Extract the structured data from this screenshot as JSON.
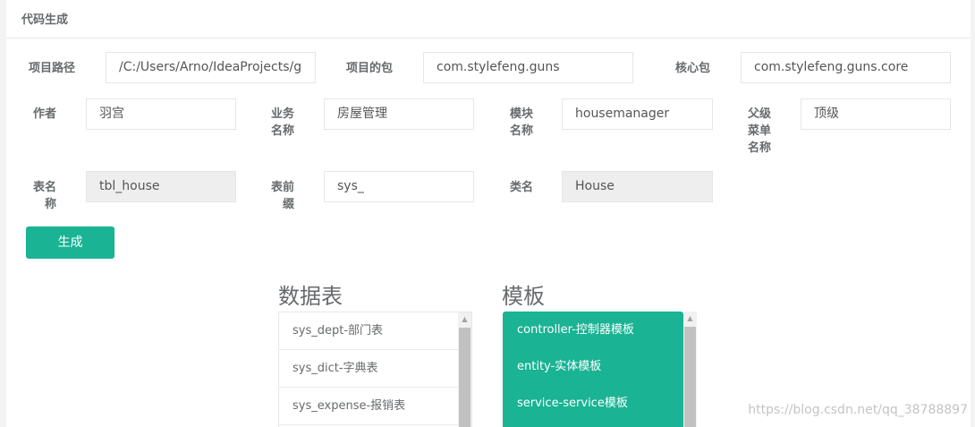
{
  "panel": {
    "title": "代码生成"
  },
  "form": {
    "project_path": {
      "label": "项目路径",
      "value": "/C:/Users/Arno/IdeaProjects/g"
    },
    "project_package": {
      "label": "项目的包",
      "value": "com.stylefeng.guns"
    },
    "core_package": {
      "label": "核心包",
      "value": "com.stylefeng.guns.core"
    },
    "author": {
      "label": "作者",
      "value": "羽宫"
    },
    "biz_name": {
      "label_line1": "业务",
      "label_line2": "名称",
      "value": "房屋管理"
    },
    "module_name": {
      "label_line1": "模块",
      "label_line2": "名称",
      "value": "housemanager"
    },
    "parent_menu": {
      "label_line1": "父级",
      "label_line2": "菜单",
      "label_line3": "名称",
      "value": "顶级"
    },
    "table_name": {
      "label_line1": "表名",
      "label_line2": "称",
      "value": "tbl_house"
    },
    "table_prefix": {
      "label_line1": "表前",
      "label_line2": "缀",
      "value": "sys_"
    },
    "class_name": {
      "label": "类名",
      "value": "House"
    },
    "generate_button": "生成"
  },
  "tables": {
    "title": "数据表",
    "items": [
      "sys_dept-部门表",
      "sys_dict-字典表",
      "sys_expense-报销表"
    ]
  },
  "templates": {
    "title": "模板",
    "items": [
      "controller-控制器模板",
      "entity-实体模板",
      "service-service模板"
    ]
  },
  "watermark": "https://blog.csdn.net/qq_38788897",
  "colors": {
    "accent": "#1ab394",
    "readonly_bg": "#eeeeee",
    "text": "#676a6c"
  }
}
